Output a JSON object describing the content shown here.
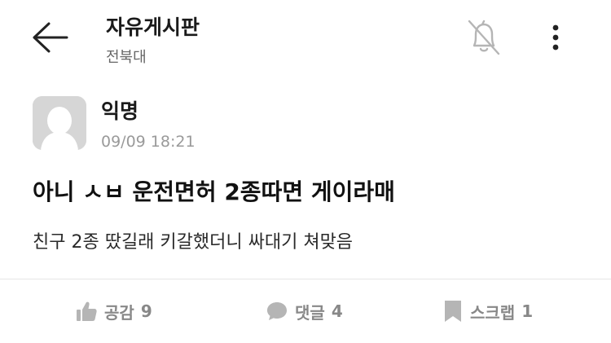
{
  "header": {
    "title": "자유게시판",
    "subtitle": "전북대",
    "icons": {
      "back": "arrow-left-icon",
      "notify": "bell-off-icon",
      "more": "more-vertical-icon"
    }
  },
  "post": {
    "author": "익명",
    "timestamp": "09/09 18:21",
    "title": "아니 ㅅㅂ 운전면허 2종따면 게이라매",
    "body": "친구 2종 땄길래 키갈했더니 싸대기 쳐맞음"
  },
  "actions": {
    "like_label": "공감",
    "like_count": "9",
    "comment_label": "댓글",
    "comment_count": "4",
    "scrap_label": "스크랩",
    "scrap_count": "1"
  },
  "colors": {
    "text_primary": "#111111",
    "text_secondary": "#666666",
    "text_muted": "#9a9a9a",
    "icon_gray": "#8a8a8a",
    "divider": "#e6e6e6",
    "avatar_bg": "#d6d6d6"
  }
}
